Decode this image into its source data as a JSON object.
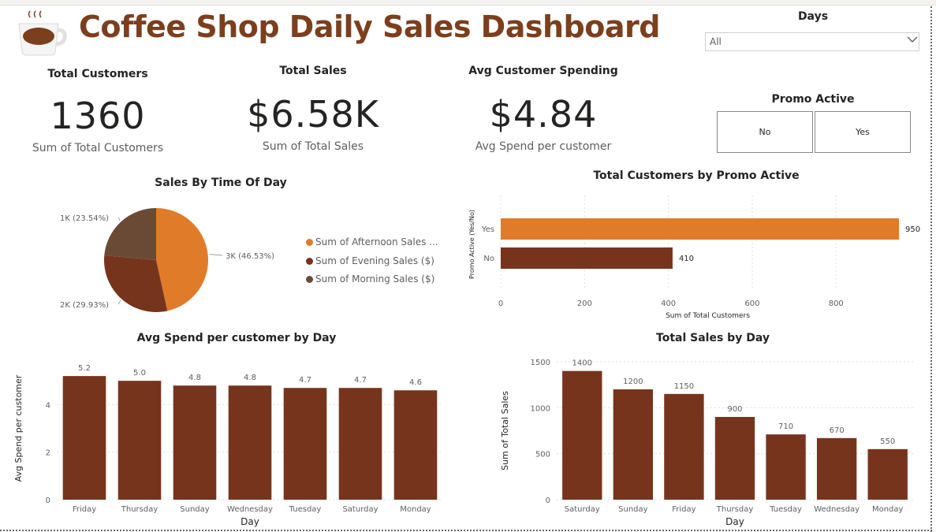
{
  "app": {
    "title": "Coffee Shop Daily Sales Dashboard"
  },
  "colors": {
    "accent": "#e07b29",
    "brown": "#77341d",
    "dark_brown": "#6b4a35",
    "title": "#7b3f1e"
  },
  "icons": {
    "logo": "coffee-cup-icon",
    "dropdown": "chevron-down-icon"
  },
  "kpis": {
    "customers": {
      "title": "Total Customers",
      "value": "1360",
      "label": "Sum of Total Customers"
    },
    "sales": {
      "title": "Total Sales",
      "value": "$6.58K",
      "label": "Sum of Total Sales"
    },
    "avg": {
      "title": "Avg Customer Spending",
      "value": "$4.84",
      "label": "Avg Spend per customer"
    }
  },
  "slicer": {
    "title": "Days",
    "value": "All"
  },
  "promo": {
    "title": "Promo Active",
    "options": [
      "No",
      "Yes"
    ]
  },
  "chart_data": [
    {
      "type": "pie",
      "title": "Sales By Time Of Day",
      "slices": [
        {
          "name": "Sum of Afternoon Sales ...",
          "label": "3K (46.53%)",
          "share": 46.53,
          "color": "#e07b29"
        },
        {
          "name": "Sum of Evening Sales ($)",
          "label": "2K (29.93%)",
          "share": 29.93,
          "color": "#77341d"
        },
        {
          "name": "Sum of Morning Sales ($)",
          "label": "1K (23.54%)",
          "share": 23.54,
          "color": "#6b4a35"
        }
      ],
      "legend": "right"
    },
    {
      "type": "bar",
      "orientation": "horizontal",
      "title": "Total Customers by Promo Active",
      "categories": [
        "Yes",
        "No"
      ],
      "values": [
        950,
        410
      ],
      "colors": [
        "#e07b29",
        "#77341d"
      ],
      "xlabel": "Sum of Total Customers",
      "ylabel": "Promo Active (Yes/No)",
      "xticks": [
        "0",
        "200",
        "400",
        "600",
        "800"
      ],
      "xlim": [
        0,
        950
      ],
      "grid": true
    },
    {
      "type": "bar",
      "title": "Avg Spend per customer by Day",
      "categories": [
        "Friday",
        "Thursday",
        "Sunday",
        "Wednesday",
        "Tuesday",
        "Saturday",
        "Monday"
      ],
      "values": [
        5.2,
        5.0,
        4.8,
        4.8,
        4.7,
        4.7,
        4.6
      ],
      "labels": [
        "5.2",
        "5.0",
        "4.8",
        "4.8",
        "4.7",
        "4.7",
        "4.6"
      ],
      "xlabel": "Day",
      "ylabel": "Avg Spend per customer",
      "yticks": [
        "0",
        "2",
        "4"
      ],
      "ylim": [
        0,
        6
      ],
      "grid": true
    },
    {
      "type": "bar",
      "title": "Total Sales by Day",
      "categories": [
        "Saturday",
        "Sunday",
        "Friday",
        "Thursday",
        "Tuesday",
        "Wednesday",
        "Monday"
      ],
      "values": [
        1400,
        1200,
        1150,
        900,
        710,
        670,
        550
      ],
      "labels": [
        "1400",
        "1200",
        "1150",
        "900",
        "710",
        "670",
        "550"
      ],
      "xlabel": "Day",
      "ylabel": "Sum of Total Sales",
      "yticks": [
        "0",
        "500",
        "1000",
        "1500"
      ],
      "ylim": [
        0,
        1500
      ],
      "grid": true
    }
  ]
}
